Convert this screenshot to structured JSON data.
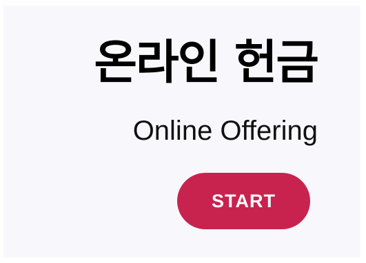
{
  "hero": {
    "title_korean": "온라인 헌금",
    "title_english": "Online Offering",
    "start_label": "START"
  },
  "colors": {
    "panel_background": "#f8f8fc",
    "button_background": "#c8234f",
    "button_text": "#ffffff",
    "title_text": "#000000"
  }
}
